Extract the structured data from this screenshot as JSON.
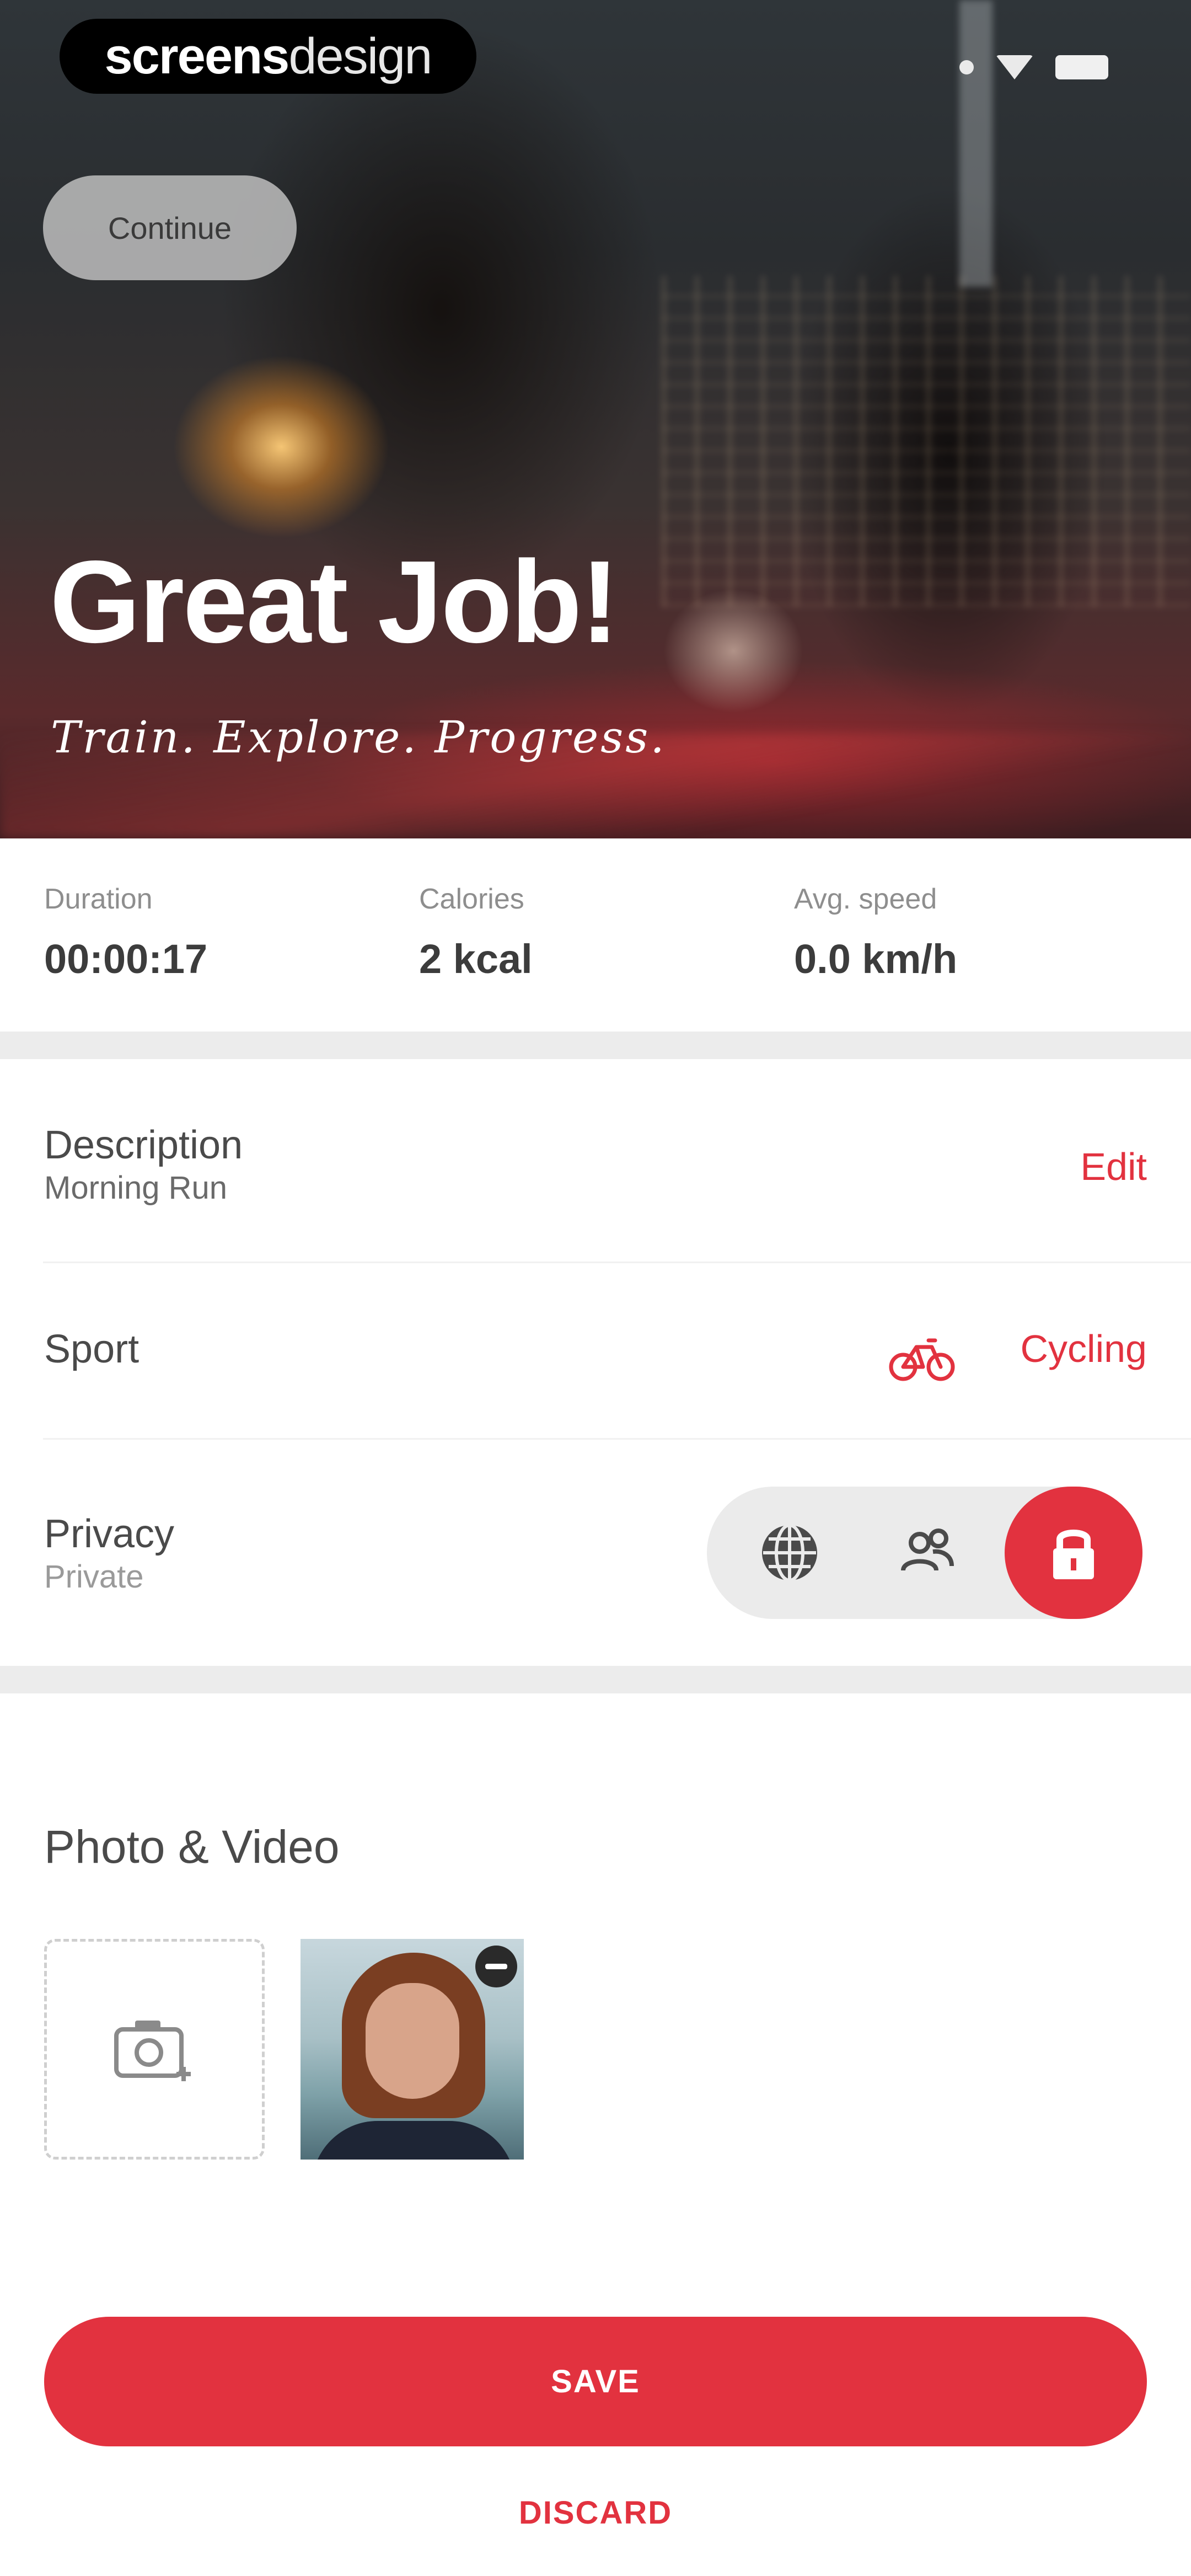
{
  "brand": {
    "bold": "screens",
    "light": "design"
  },
  "hero": {
    "continue_label": "Continue",
    "title": "Great Job!",
    "subtitle": "Train. Explore. Progress."
  },
  "stats": [
    {
      "label": "Duration",
      "value": "00:00:17"
    },
    {
      "label": "Calories",
      "value": "2 kcal"
    },
    {
      "label": "Avg. speed",
      "value": "0.0 km/h"
    }
  ],
  "description": {
    "title": "Description",
    "value": "Morning Run",
    "action": "Edit"
  },
  "sport": {
    "title": "Sport",
    "value": "Cycling",
    "icon": "bicycle-icon"
  },
  "privacy": {
    "title": "Privacy",
    "value": "Private",
    "options": [
      "globe-icon",
      "friends-icon",
      "lock-icon"
    ],
    "selected": "lock-icon"
  },
  "media": {
    "title": "Photo & Video"
  },
  "actions": {
    "save": "SAVE",
    "discard": "DISCARD"
  },
  "colors": {
    "accent": "#e2323f",
    "divider": "#ececec",
    "pill": "#ebebeb"
  }
}
